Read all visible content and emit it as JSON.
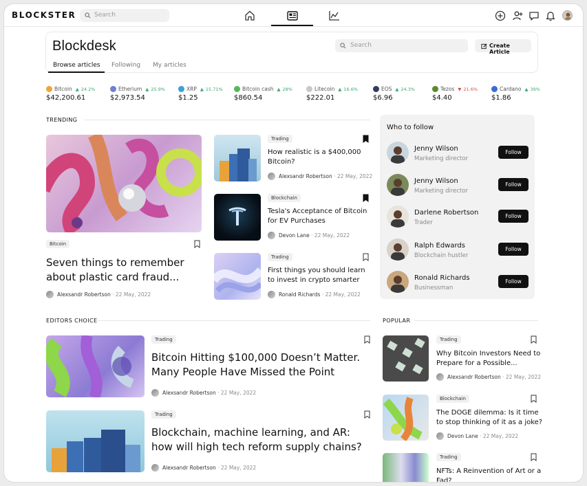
{
  "app": {
    "logo": "BLOCKSTER",
    "search_placeholder": "Search"
  },
  "icons": {
    "nav": [
      "home-icon",
      "news-icon",
      "chart-icon"
    ],
    "right": [
      "plus-circle-icon",
      "add-user-icon",
      "chat-icon",
      "bell-icon",
      "avatar"
    ]
  },
  "header": {
    "title": "Blockdesk",
    "tabs": [
      "Browse articles",
      "Following",
      "My articles"
    ],
    "search_placeholder": "Search",
    "create_label": "Create Article"
  },
  "ticker": [
    {
      "name": "Bitcoin",
      "change": "24.2%",
      "price": "$42,200.61",
      "color": "#f2a33a",
      "dir": "up"
    },
    {
      "name": "Etherium",
      "change": "25.9%",
      "price": "$2,973.54",
      "color": "#6d7fd8",
      "dir": "up"
    },
    {
      "name": "XRP",
      "change": "15.71%",
      "price": "$1.25",
      "color": "#3aa0d8",
      "dir": "up"
    },
    {
      "name": "Bitcoin cash",
      "change": "28%",
      "price": "$860.54",
      "color": "#54b95a",
      "dir": "up"
    },
    {
      "name": "Litecoin",
      "change": "16.6%",
      "price": "$222.01",
      "color": "#c8c8c8",
      "dir": "up"
    },
    {
      "name": "EOS",
      "change": "24.3%",
      "price": "$6.96",
      "color": "#333d5c",
      "dir": "up"
    },
    {
      "name": "Tezos",
      "change": "21.6%",
      "price": "$4.40",
      "color": "#5a8a2a",
      "dir": "down"
    },
    {
      "name": "Cardano",
      "change": "39%",
      "price": "$1.86",
      "color": "#3a6bd8",
      "dir": "up"
    }
  ],
  "trending": {
    "label": "TRENDING",
    "featured": {
      "tag": "Bitcoin",
      "title_line1": "Seven things to remember",
      "title_line2": "about plastic card fraud...",
      "author": "Alexsandr Robertson",
      "date": "· 22 May, 2022"
    },
    "items": [
      {
        "tag": "Trading",
        "line1": "How realistic is a $400,000",
        "line2": "Bitcoin?",
        "author": "Alexsandr Robertson",
        "date": "· 22 May, 2022"
      },
      {
        "tag": "Blockchain",
        "line1": "Tesla's Acceptance of Bitcoin",
        "line2": "for EV Purchases",
        "author": "Devon Lane",
        "date": "· 22 May, 2022"
      },
      {
        "tag": "Trading",
        "line1": "First things you should learn",
        "line2": "to invest in crypto smarter",
        "author": "Ronald Richards",
        "date": "· 22 May, 2022"
      }
    ]
  },
  "who_to_follow": {
    "title": "Who to follow",
    "follow_label": "Follow",
    "people": [
      {
        "name": "Jenny Wilson",
        "role": "Marketing director"
      },
      {
        "name": "Jenny Wilson",
        "role": "Marketing director"
      },
      {
        "name": "Darlene Robertson",
        "role": "Trader"
      },
      {
        "name": "Ralph Edwards",
        "role": "Blockchain hustler"
      },
      {
        "name": "Ronald Richards",
        "role": "Businessman"
      }
    ]
  },
  "editors_choice": {
    "label": "EDITORS CHOICE",
    "items": [
      {
        "tag": "Trading",
        "line1": "Bitcoin Hitting $100,000 Doesn’t Matter.",
        "line2": "Many People Have Missed the Point",
        "author": "Alexsandr Robertson",
        "date": "· 22 May, 2022"
      },
      {
        "tag": "Trading",
        "line1": "Blockchain, machine learning, and AR:",
        "line2": "how will high tech reform supply chains?",
        "author": "Alexsandr Robertson",
        "date": "· 22 May, 2022"
      }
    ]
  },
  "popular": {
    "label": "POPULAR",
    "items": [
      {
        "tag": "Trading",
        "line1": "Why Bitcoin Investors Need to",
        "line2": "Prepare for a Possible...",
        "author": "Alexsandr Robertson",
        "date": "· 22 May, 2022"
      },
      {
        "tag": "Blockchain",
        "line1": "The DOGE dilemma: Is it time",
        "line2": "to stop thinking of it as a joke?",
        "author": "Devon Lane",
        "date": "· 22 May, 2022"
      },
      {
        "tag": "Trading",
        "line1": "NFTs: A Reinvention of Art or a",
        "line2": "Fad?",
        "author": "",
        "date": ""
      }
    ]
  }
}
